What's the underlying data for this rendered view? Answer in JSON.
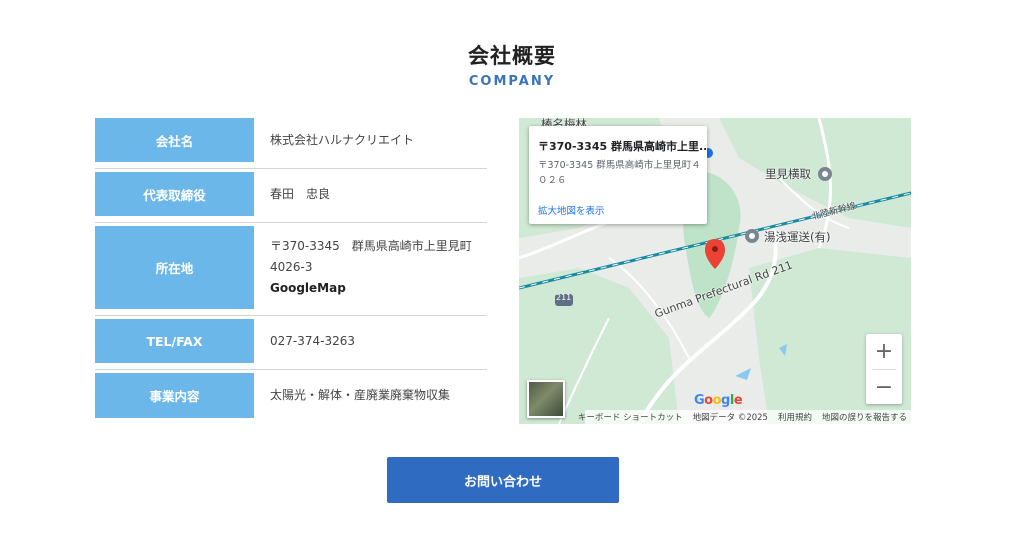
{
  "header": {
    "title": "会社概要",
    "subtitle": "COMPANY"
  },
  "table": {
    "rows": [
      {
        "label": "会社名",
        "lines": [
          "株式会社ハルナクリエイト"
        ]
      },
      {
        "label": "代表取締役",
        "lines": [
          "春田　忠良"
        ]
      },
      {
        "label": "所在地",
        "lines": [
          "〒370-3345　群馬県高崎市上里見町",
          "4026-3"
        ],
        "link": "GoogleMap"
      },
      {
        "label": "TEL/FAX",
        "lines": [
          "027-374-3263"
        ]
      },
      {
        "label": "事業内容",
        "lines": [
          "太陽光・解体・産廃業廃棄物収集"
        ]
      }
    ]
  },
  "map": {
    "popup": {
      "title": "〒370-3345 群馬県高崎市上里...",
      "address": "〒370-3345 群馬県高崎市上里見町４０２６",
      "link": "拡大地図を表示"
    },
    "pois": [
      "里見横取",
      "湯浅運送(有)",
      "榛名梅林"
    ],
    "road_labels": [
      "Gunma Prefectural Rd 211",
      "北陸新幹線",
      "211"
    ],
    "zoom_in": "+",
    "zoom_out": "−",
    "brand": "Google",
    "attribution": [
      "キーボード ショートカット",
      "地図データ ©2025",
      "利用規約",
      "地図の誤りを報告する"
    ],
    "colors": {
      "marker": "#ea4335",
      "rail": "#1a8aa0",
      "green": "#c9ead0"
    }
  },
  "cta": {
    "label": "お問い合わせ"
  }
}
